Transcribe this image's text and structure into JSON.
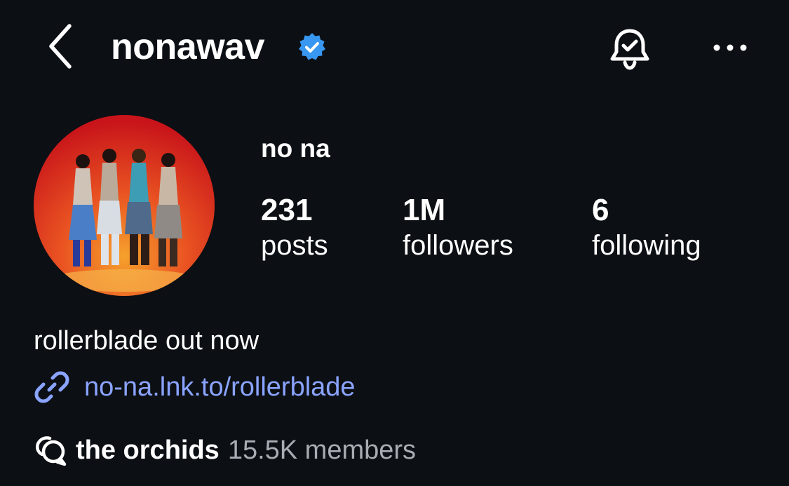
{
  "header": {
    "username": "nonawav",
    "verified": true,
    "back_icon": "chevron-left-icon",
    "verified_icon": "verified-badge-icon",
    "notification_icon": "bell-check-icon",
    "more_icon": "more-horizontal-icon"
  },
  "profile": {
    "display_name": "no na",
    "avatar_description": "profile photo",
    "stats": [
      {
        "value": "231",
        "label": "posts"
      },
      {
        "value": "1M",
        "label": "followers"
      },
      {
        "value": "6",
        "label": "following"
      }
    ]
  },
  "bio": {
    "text": "rollerblade out now",
    "link_icon": "link-icon",
    "link": "no-na.lnk.to/rollerblade"
  },
  "channel": {
    "icon": "broadcast-channel-icon",
    "name": "the orchids",
    "members": "15.5K members"
  },
  "colors": {
    "background": "#0c0f14",
    "text": "#ffffff",
    "link": "#8aa4ff",
    "verified": "#3897f0",
    "muted": "#a8acb3"
  }
}
